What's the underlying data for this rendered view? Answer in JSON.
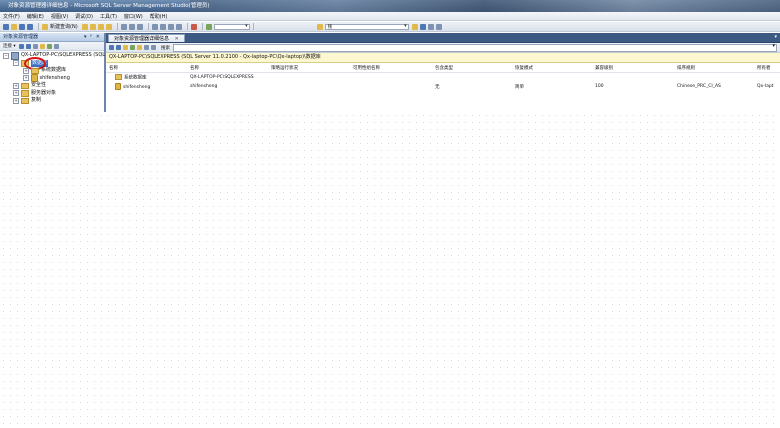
{
  "window": {
    "title": "对象资源管理器详细信息 - Microsoft SQL Server Management Studio(管理员)"
  },
  "menu": {
    "items": [
      "文件(F)",
      "编辑(E)",
      "视图(V)",
      "调试(D)",
      "工具(T)",
      "窗口(W)",
      "帮助(H)"
    ]
  },
  "toolbar": {
    "new_query_label": "新建查询(N)",
    "database_combo_value": "",
    "find_combo_value": "钱"
  },
  "object_explorer": {
    "title": "对象资源管理器",
    "header_controls": "▾ ᵖ ✕",
    "connect_label": "连接 ▾",
    "tree": {
      "server": "QX-LAPTOP-PC\\SQLEXPRESS (SQL S",
      "databases": "数据库",
      "system_databases": "系统数据库",
      "user_database": "shifensheng",
      "security": "安全性",
      "server_objects": "服务器对象",
      "replication": "复制"
    }
  },
  "details": {
    "tab_title": "对象资源管理器详细信息",
    "tab_close": "✕",
    "search_label": "搜索",
    "search_value": "",
    "path": "QX-LAPTOP-PC\\SQLEXPRESS (SQL Server 11.0.2100 - Qx-laptop-PC\\Qx-laptop)\\数据库",
    "columns": [
      "名称",
      "名称",
      "策略运行状况",
      "可用性组名称",
      "包含类型",
      "恢复模式",
      "兼容级别",
      "排序规则",
      "所有者"
    ],
    "rows": [
      [
        "系统数据库",
        "QX-LAPTOP-PC\\SQLEXPRESS",
        "",
        "",
        "",
        "",
        "",
        "",
        ""
      ],
      [
        "shifensheng",
        "shifensheng",
        "",
        "",
        "无",
        "简单",
        "100",
        "Chinese_PRC_CI_AS",
        "Qx-lapt"
      ]
    ]
  }
}
